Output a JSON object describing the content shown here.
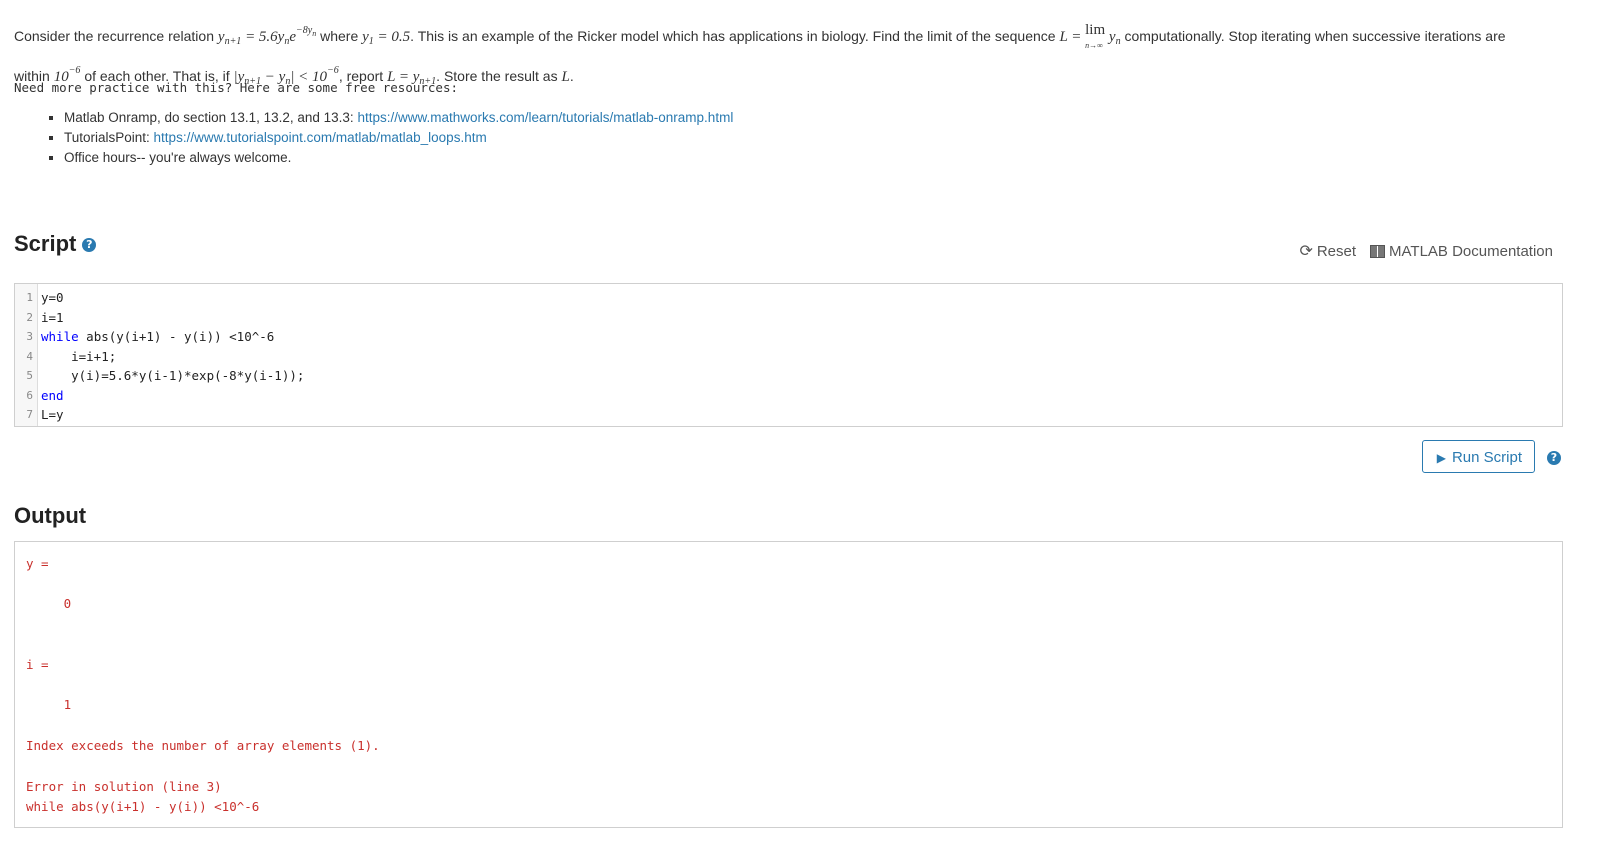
{
  "problem": {
    "t1": "Consider the recurrence relation ",
    "t2": " where ",
    "t3": ". This is an example of the Ricker model which has applications in biology. Find the limit of the sequence ",
    "t4": " computationally. Stop iterating when successive iterations are",
    "t5": "within ",
    "t6": " of each other. That is, if ",
    "t7": ", report ",
    "t8": ". Store the result as ",
    "t9": ".",
    "eq_recurrence_lhs": "y",
    "eq_sub_n1": "n+1",
    "eq_eq_56": " = 5.6y",
    "eq_sub_n": "n",
    "eq_e": "e",
    "eq_exp": "−8y",
    "eq_exp_sub": "n",
    "eq_y1": "y",
    "eq_y1_sub": "1",
    "eq_y1_val": " = 0.5",
    "eq_L": "L = ",
    "eq_lim": "lim",
    "eq_lim_under": "n→∞",
    "eq_yn": " y",
    "eq_yn_sub": "n",
    "eq_tol": "10",
    "eq_tol_exp": "−6",
    "eq_abs": "|y",
    "eq_abs_sub1": "n+1",
    "eq_abs_mid": " − y",
    "eq_abs_sub2": "n",
    "eq_abs_tail": "| < 10",
    "eq_abs_exp": "−6",
    "eq_report": "L = y",
    "eq_report_sub": "n+1",
    "eq_L_store": "L"
  },
  "practice": {
    "intro": "Need more practice with this?  Here are some free resources:",
    "items": [
      {
        "label": "Matlab Onramp, do section 13.1, 13.2, and 13.3: ",
        "link": "https://www.mathworks.com/learn/tutorials/matlab-onramp.html"
      },
      {
        "label": "TutorialsPoint: ",
        "link": "https://www.tutorialspoint.com/matlab/matlab_loops.htm"
      },
      {
        "label": "Office hours-- you're always welcome.",
        "link": ""
      }
    ]
  },
  "script": {
    "title": "Script",
    "reset_label": "Reset",
    "docs_label": "MATLAB Documentation",
    "lines": [
      {
        "n": "1",
        "kw": "",
        "code": "y=0"
      },
      {
        "n": "2",
        "kw": "",
        "code": "i=1"
      },
      {
        "n": "3",
        "kw": "while",
        "code": " abs(y(i+1) - y(i)) <10^-6"
      },
      {
        "n": "4",
        "kw": "",
        "code": "    i=i+1;"
      },
      {
        "n": "5",
        "kw": "",
        "code": "    y(i)=5.6*y(i-1)*exp(-8*y(i-1));"
      },
      {
        "n": "6",
        "kw": "end",
        "code": ""
      },
      {
        "n": "7",
        "kw": "",
        "code": "L=y"
      }
    ],
    "run_label": "Run Script"
  },
  "output": {
    "title": "Output",
    "lines": [
      "y =",
      "     0",
      "i =",
      "     1",
      "Index exceeds the number of array elements (1).",
      "Error in solution (line 3)",
      "while abs(y(i+1) - y(i)) <10^-6"
    ]
  },
  "colors": {
    "link": "#2a7ab0",
    "error": "#c9302c",
    "keyword": "#0000ff"
  }
}
